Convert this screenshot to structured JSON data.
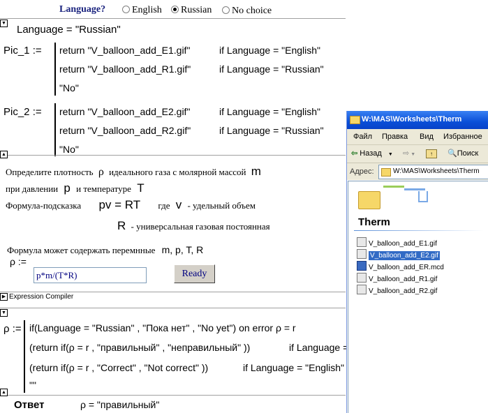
{
  "language_bar": {
    "question": "Language?",
    "options": [
      {
        "label": "English",
        "selected": false
      },
      {
        "label": "Russian",
        "selected": true
      },
      {
        "label": "No choice",
        "selected": false
      }
    ]
  },
  "language_assign": "Language = \"Russian\"",
  "pic1": {
    "name": "Pic_1 :=",
    "lines": [
      {
        "expr": "return  \"V_balloon_add_E1.gif\"",
        "cond": "if   Language = \"English\""
      },
      {
        "expr": "return  \"V_balloon_add_R1.gif\"",
        "cond": "if   Language = \"Russian\""
      },
      {
        "expr": "\"No\"",
        "cond": ""
      }
    ]
  },
  "pic2": {
    "name": "Pic_2 :=",
    "lines": [
      {
        "expr": "return  \"V_balloon_add_E2.gif\"",
        "cond": "if   Language = \"English\""
      },
      {
        "expr": "return  \"V_balloon_add_R2.gif\"",
        "cond": "if   Language = \"Russian\""
      },
      {
        "expr": "\"No\"",
        "cond": ""
      }
    ]
  },
  "problem": {
    "line1_text": "Определите плотность",
    "line1_rho": "ρ",
    "line1_text2": "идеального газа с молярной массой",
    "line1_m": "m",
    "line2_text": "при давлении",
    "line2_p": "p",
    "line2_text2": "и температуре",
    "line2_T": "T",
    "line3_text": "Формула-подсказка",
    "line3_formula": "pv = RT",
    "line3_text2": "где",
    "line3_v": "v",
    "line3_text3": "- удельный объем",
    "line4_R": "R",
    "line4_text": "- универсальная газовая постоянная",
    "line5_text": "Формула может содержать перемнные",
    "line5_vars": "m, p, T, R",
    "rho_label": "ρ  :=",
    "input_value": "p*m/(T*R)",
    "ready_label": "Ready"
  },
  "expression_compiler_label": "Expression Compiler",
  "result_block": {
    "name": "ρ :=",
    "line1": "if(Language = \"Russian\" , \"Пока нет\" , \"No yet\")    on error  ρ = r",
    "line2_expr": "(return  if(ρ = r , \"правильный\" , \"неправильный\" ))",
    "line2_cond": "if   Language = \"Russian\"",
    "line3_expr": "(return  if(ρ = r , \"Correct\" , \"Not correct\" ))",
    "line3_cond": "if   Language = \"English\"",
    "line4": "\"\""
  },
  "answer": {
    "label": "Ответ",
    "value": "ρ = \"правильный\""
  },
  "explorer": {
    "title": "W:\\MAS\\Worksheets\\Therm",
    "menu": [
      "Файл",
      "Правка",
      "Вид",
      "Избранное"
    ],
    "back_label": "Назад",
    "search_label": "Поиск",
    "address_label": "Адрес:",
    "address_value": "W:\\MAS\\Worksheets\\Therm",
    "folder_name": "Therm",
    "files": [
      {
        "name": "V_balloon_add_E1.gif",
        "selected": false
      },
      {
        "name": "V_balloon_add_E2.gif",
        "selected": true
      },
      {
        "name": "V_balloon_add_ER.mcd",
        "selected": false
      },
      {
        "name": "V_balloon_add_R1.gif",
        "selected": false
      },
      {
        "name": "V_balloon_add_R2.gif",
        "selected": false
      }
    ],
    "colors": {
      "title_bar": "#0a4fd8",
      "selection": "#316ac5",
      "toolbar": "#ece9d8"
    }
  }
}
